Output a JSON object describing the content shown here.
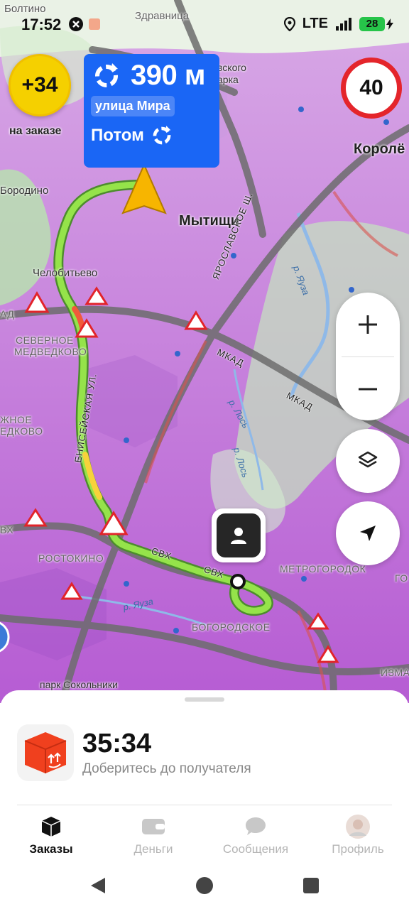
{
  "status_bar": {
    "time": "17:52",
    "network": "LTE",
    "battery": "28"
  },
  "bonus": {
    "value": "+34",
    "caption": "на заказе"
  },
  "maneuver": {
    "distance": "390 м",
    "street": "улица Мира",
    "then_label": "Потом"
  },
  "speed_limit": "40",
  "map_labels": {
    "boltino": "Болтино",
    "zdravnitsa": "Здравница",
    "park_partial": "вского\nарка",
    "borodino": "Бородино",
    "mytishchi": "Мытищи",
    "korolev": "Королё",
    "chelobitevo": "Челобитьево",
    "severnoe_medvedkovo_1": "СЕВЕРНОЕ",
    "severnoe_medvedkovo_2": "МЕДВЕДКОВО",
    "yuzhnoe_1": "ЖНОЕ",
    "yuzhnoe_2": "ЕДКОВО",
    "yaroslavskoe": "ЯРОСЛАВСКОЕ Ш.",
    "mkad_1": "МКАД",
    "mkad_2": "МКАД",
    "eniseyskaya": "ЕНИСЕЙСКАЯ УЛ.",
    "r_yauza_top": "р. Яуза",
    "r_los_1": "р. Лось",
    "r_los_2": "р. Лось",
    "rostokino": "РОСТОКИНО",
    "svh_1": "СВХ",
    "svh_2": "СВХ",
    "metrogorodok": "МЕТРОГОРОДОК",
    "r_yauza_bottom": "р. Яуза",
    "bogorodskoe": "БОГОРОДСКОЕ",
    "park_sokolniki": "парк Сокольники",
    "izma": "ИЗМА",
    "ad_left": "АД",
    "vh_left": "ВХ",
    "go_right": "ГО",
    "korol_partial": "Кор"
  },
  "order": {
    "eta": "35:34",
    "subtitle": "Доберитесь до получателя"
  },
  "tabs": [
    {
      "label": "Заказы",
      "icon": "boxes-icon",
      "active": true
    },
    {
      "label": "Деньги",
      "icon": "wallet-icon",
      "active": false
    },
    {
      "label": "Сообщения",
      "icon": "chat-icon",
      "active": false
    },
    {
      "label": "Профиль",
      "icon": "avatar-icon",
      "active": false
    }
  ],
  "colors": {
    "maneuver_bg": "#1a66f5",
    "route_green": "#8bdc3a",
    "speed_limit_ring": "#e4252b",
    "bonus_yellow": "#f5d000",
    "order_icon_red": "#f0401e"
  }
}
